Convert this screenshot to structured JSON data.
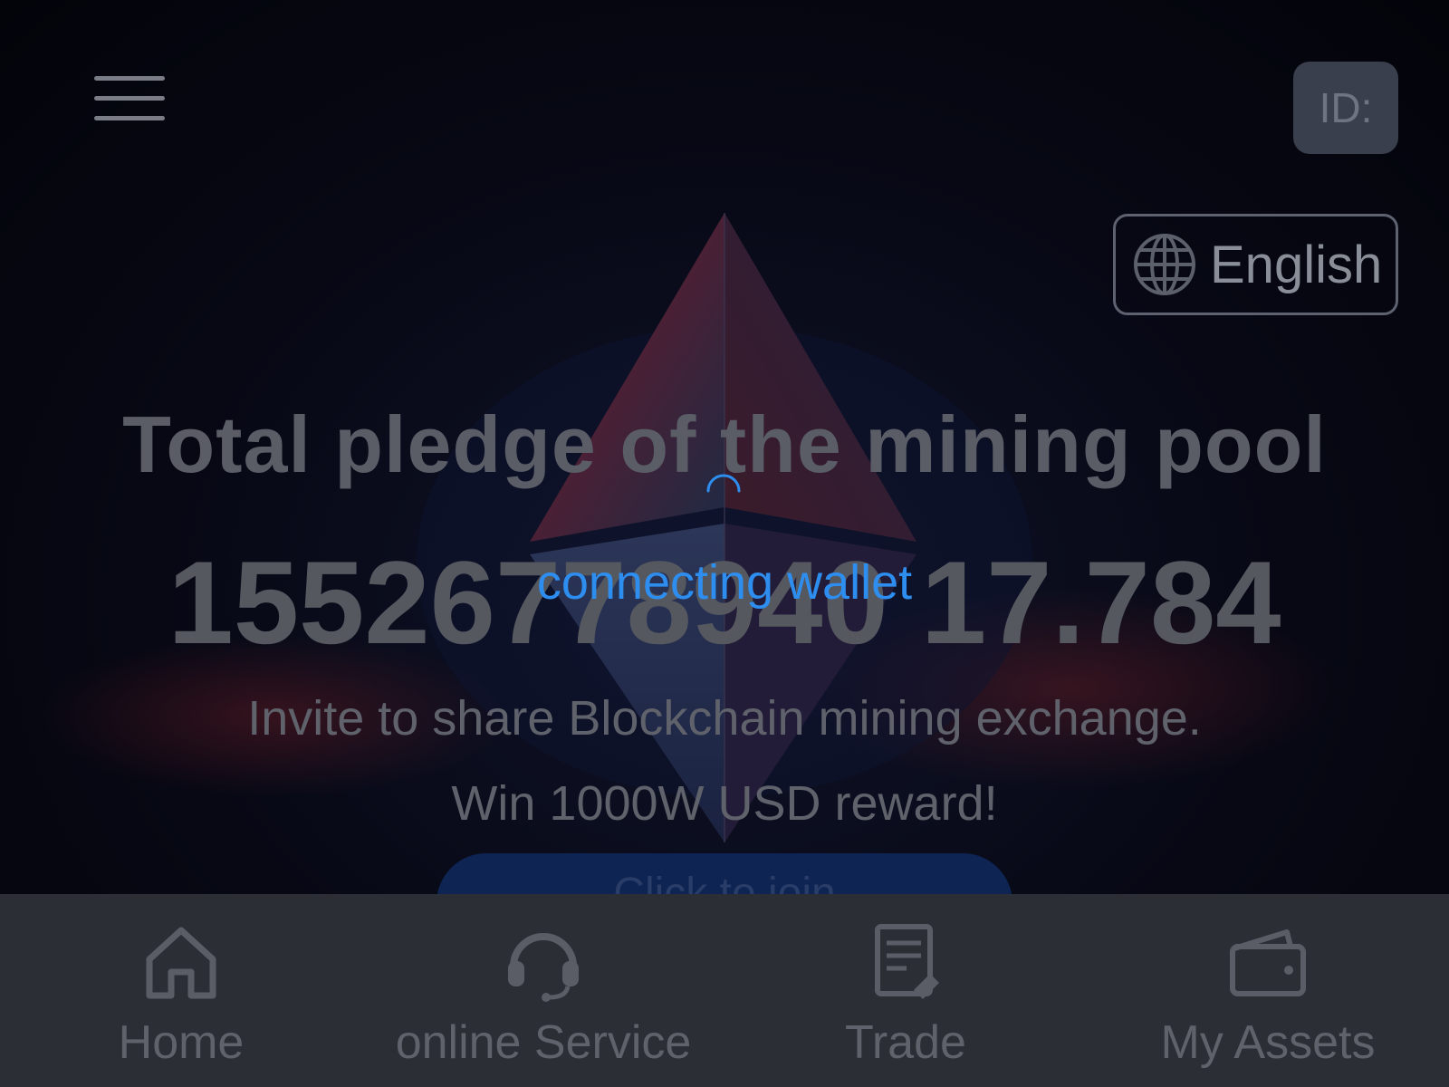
{
  "header": {
    "menu_icon": "hamburger-menu-icon",
    "id_label": "ID:",
    "language": {
      "icon": "globe-icon",
      "label": "English"
    }
  },
  "hero": {
    "title": "Total pledge of the mining pool",
    "total_pledge": "15526778940 17.784",
    "invite_text": "Invite to share Blockchain mining exchange.",
    "reward_text": "Win 1000W USD reward!",
    "cta_label": "Click to join"
  },
  "overlay": {
    "loading_text": "connecting wallet",
    "spinner_color": "#2e8ef0"
  },
  "tabbar": {
    "items": [
      {
        "label": "Home",
        "icon": "home-icon"
      },
      {
        "label": "online Service",
        "icon": "headset-icon"
      },
      {
        "label": "Trade",
        "icon": "trade-document-icon"
      },
      {
        "label": "My Assets",
        "icon": "wallet-icon"
      }
    ]
  }
}
